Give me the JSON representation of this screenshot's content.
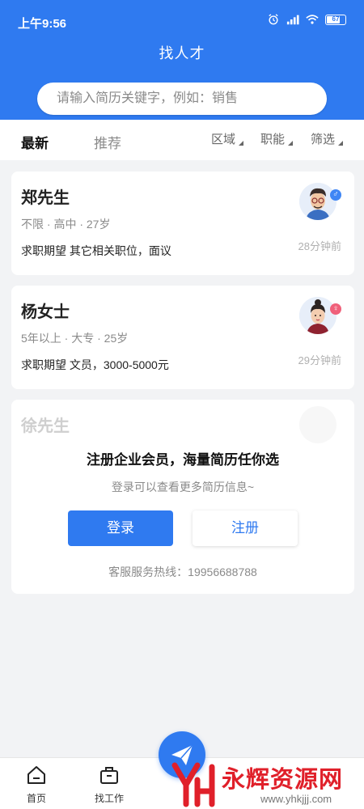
{
  "status_bar": {
    "time": "上午9:56",
    "battery": "67"
  },
  "header": {
    "title": "找人才"
  },
  "search": {
    "placeholder": "请输入简历关键字，例如：销售"
  },
  "tabs": {
    "items": [
      {
        "label": "最新",
        "active": true
      },
      {
        "label": "推荐",
        "active": false
      }
    ],
    "filters": [
      "区域",
      "职能",
      "筛选"
    ]
  },
  "candidates": [
    {
      "name": "郑先生",
      "meta": "不限 · 高中 · 27岁",
      "expectation": "求职期望 其它相关职位，面议",
      "time_ago": "28分钟前",
      "gender": "male"
    },
    {
      "name": "杨女士",
      "meta": "5年以上 · 大专 · 25岁",
      "expectation": "求职期望 文员，3000-5000元",
      "time_ago": "29分钟前",
      "gender": "female"
    }
  ],
  "locked_card": {
    "name": "徐先生",
    "title": "注册企业会员，海量简历任你选",
    "subtitle": "登录可以查看更多简历信息~",
    "login_label": "登录",
    "register_label": "注册",
    "hotline": "客服服务热线：19956688788"
  },
  "bottom_nav": {
    "items": [
      {
        "label": "首页",
        "icon": "home-icon"
      },
      {
        "label": "找工作",
        "icon": "briefcase-icon"
      }
    ]
  },
  "watermark": {
    "text": "永辉资源网",
    "url": "www.yhkjjj.com"
  },
  "colors": {
    "accent": "#2f7af0",
    "male": "#3f86f5",
    "female": "#f0607a",
    "watermark": "#e0202a"
  }
}
